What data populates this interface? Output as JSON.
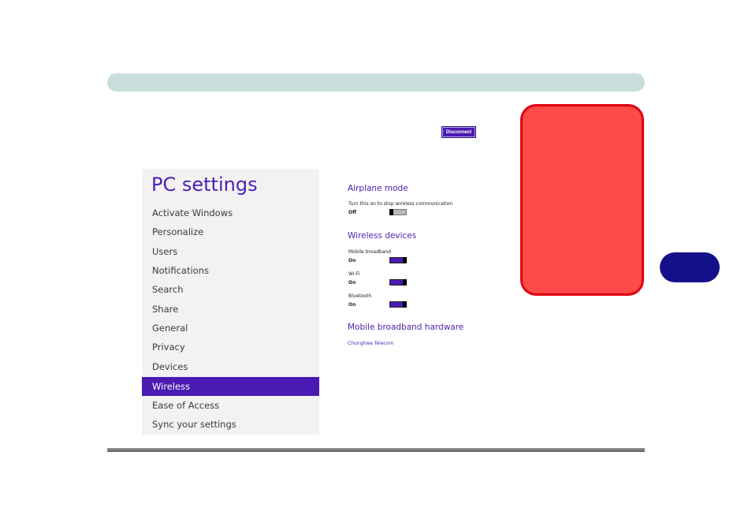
{
  "document": {
    "chapter_tab": "",
    "disconnect_label": "Disconnect",
    "warning_text": ""
  },
  "sidebar": {
    "title": "PC settings",
    "items": [
      {
        "label": "Activate Windows"
      },
      {
        "label": "Personalize"
      },
      {
        "label": "Users"
      },
      {
        "label": "Notifications"
      },
      {
        "label": "Search"
      },
      {
        "label": "Share"
      },
      {
        "label": "General"
      },
      {
        "label": "Privacy"
      },
      {
        "label": "Devices"
      },
      {
        "label": "Wireless",
        "selected": true
      },
      {
        "label": "Ease of Access"
      },
      {
        "label": "Sync your settings"
      }
    ]
  },
  "wireless": {
    "airplane": {
      "title": "Airplane mode",
      "description": "Turn this on to stop wireless communication",
      "state": "Off",
      "on": false
    },
    "devices": {
      "title": "Wireless devices",
      "items": [
        {
          "label": "Mobile broadband",
          "state": "On",
          "on": true
        },
        {
          "label": "Wi-Fi",
          "state": "On",
          "on": true
        },
        {
          "label": "Bluetooth",
          "state": "On",
          "on": true
        }
      ]
    },
    "hardware": {
      "title": "Mobile broadband hardware",
      "link": "Chunghwa Telecom"
    }
  },
  "colors": {
    "accent": "#4a1bb2",
    "header_bar": "#c9dfdc",
    "warning_fill": "#ff4a4a",
    "warning_border": "#e00010",
    "chapter_tab": "#14108a"
  }
}
